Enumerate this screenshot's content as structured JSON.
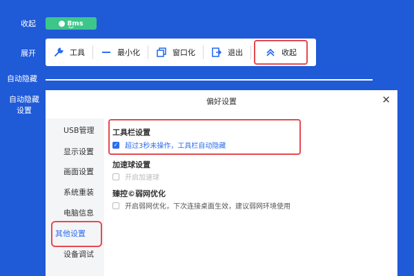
{
  "labels": {
    "collapse": "收起",
    "expand": "展开",
    "auto_hide": "自动隐藏",
    "auto_hide_settings": "自动隐藏\n设置"
  },
  "ping": {
    "value": "8ms"
  },
  "toolbar": {
    "tool_label": "工具",
    "minimize_label": "最小化",
    "windowed_label": "窗口化",
    "exit_label": "退出",
    "collapse_label": "收起"
  },
  "dialog": {
    "title": "偏好设置",
    "close": "✕",
    "nav": [
      "USB管理",
      "显示设置",
      "画面设置",
      "系统重装",
      "电脑信息",
      "其他设置",
      "设备调试"
    ],
    "active_nav": "其他设置",
    "sections": {
      "toolbar_settings": {
        "title": "工具栏设置",
        "option": "超过3秒未操作，工具栏自动隐藏",
        "checked": true
      },
      "accel_ball": {
        "title": "加速球设置",
        "option": "开启加速球",
        "checked": false
      },
      "weak_net": {
        "title": "臻控©弱网优化",
        "option": "开启弱网优化，下次连接桌面生效，建议弱网环境使用",
        "checked": false
      }
    }
  },
  "colors": {
    "background": "#1f5ad7",
    "accent": "#2b6df0",
    "ping_green": "#3cc68a",
    "highlight_red": "#e5484d"
  }
}
